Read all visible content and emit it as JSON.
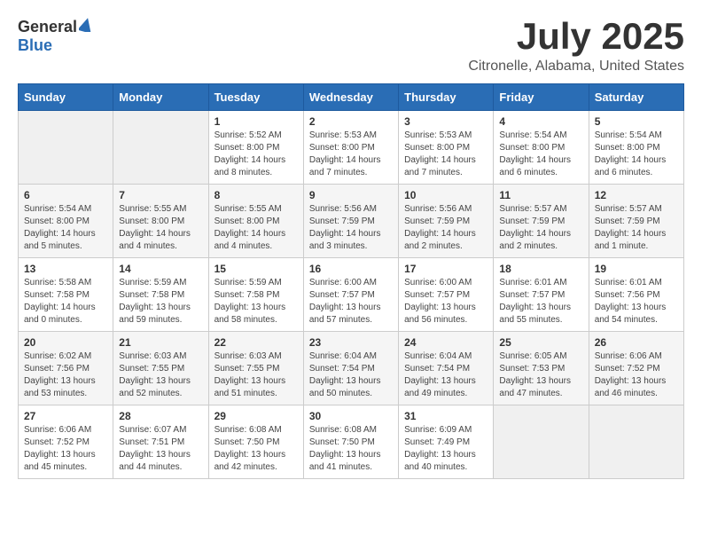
{
  "header": {
    "logo_general": "General",
    "logo_blue": "Blue",
    "title": "July 2025",
    "subtitle": "Citronelle, Alabama, United States"
  },
  "weekdays": [
    "Sunday",
    "Monday",
    "Tuesday",
    "Wednesday",
    "Thursday",
    "Friday",
    "Saturday"
  ],
  "weeks": [
    [
      {
        "day": "",
        "info": ""
      },
      {
        "day": "",
        "info": ""
      },
      {
        "day": "1",
        "info": "Sunrise: 5:52 AM\nSunset: 8:00 PM\nDaylight: 14 hours and 8 minutes."
      },
      {
        "day": "2",
        "info": "Sunrise: 5:53 AM\nSunset: 8:00 PM\nDaylight: 14 hours and 7 minutes."
      },
      {
        "day": "3",
        "info": "Sunrise: 5:53 AM\nSunset: 8:00 PM\nDaylight: 14 hours and 7 minutes."
      },
      {
        "day": "4",
        "info": "Sunrise: 5:54 AM\nSunset: 8:00 PM\nDaylight: 14 hours and 6 minutes."
      },
      {
        "day": "5",
        "info": "Sunrise: 5:54 AM\nSunset: 8:00 PM\nDaylight: 14 hours and 6 minutes."
      }
    ],
    [
      {
        "day": "6",
        "info": "Sunrise: 5:54 AM\nSunset: 8:00 PM\nDaylight: 14 hours and 5 minutes."
      },
      {
        "day": "7",
        "info": "Sunrise: 5:55 AM\nSunset: 8:00 PM\nDaylight: 14 hours and 4 minutes."
      },
      {
        "day": "8",
        "info": "Sunrise: 5:55 AM\nSunset: 8:00 PM\nDaylight: 14 hours and 4 minutes."
      },
      {
        "day": "9",
        "info": "Sunrise: 5:56 AM\nSunset: 7:59 PM\nDaylight: 14 hours and 3 minutes."
      },
      {
        "day": "10",
        "info": "Sunrise: 5:56 AM\nSunset: 7:59 PM\nDaylight: 14 hours and 2 minutes."
      },
      {
        "day": "11",
        "info": "Sunrise: 5:57 AM\nSunset: 7:59 PM\nDaylight: 14 hours and 2 minutes."
      },
      {
        "day": "12",
        "info": "Sunrise: 5:57 AM\nSunset: 7:59 PM\nDaylight: 14 hours and 1 minute."
      }
    ],
    [
      {
        "day": "13",
        "info": "Sunrise: 5:58 AM\nSunset: 7:58 PM\nDaylight: 14 hours and 0 minutes."
      },
      {
        "day": "14",
        "info": "Sunrise: 5:59 AM\nSunset: 7:58 PM\nDaylight: 13 hours and 59 minutes."
      },
      {
        "day": "15",
        "info": "Sunrise: 5:59 AM\nSunset: 7:58 PM\nDaylight: 13 hours and 58 minutes."
      },
      {
        "day": "16",
        "info": "Sunrise: 6:00 AM\nSunset: 7:57 PM\nDaylight: 13 hours and 57 minutes."
      },
      {
        "day": "17",
        "info": "Sunrise: 6:00 AM\nSunset: 7:57 PM\nDaylight: 13 hours and 56 minutes."
      },
      {
        "day": "18",
        "info": "Sunrise: 6:01 AM\nSunset: 7:57 PM\nDaylight: 13 hours and 55 minutes."
      },
      {
        "day": "19",
        "info": "Sunrise: 6:01 AM\nSunset: 7:56 PM\nDaylight: 13 hours and 54 minutes."
      }
    ],
    [
      {
        "day": "20",
        "info": "Sunrise: 6:02 AM\nSunset: 7:56 PM\nDaylight: 13 hours and 53 minutes."
      },
      {
        "day": "21",
        "info": "Sunrise: 6:03 AM\nSunset: 7:55 PM\nDaylight: 13 hours and 52 minutes."
      },
      {
        "day": "22",
        "info": "Sunrise: 6:03 AM\nSunset: 7:55 PM\nDaylight: 13 hours and 51 minutes."
      },
      {
        "day": "23",
        "info": "Sunrise: 6:04 AM\nSunset: 7:54 PM\nDaylight: 13 hours and 50 minutes."
      },
      {
        "day": "24",
        "info": "Sunrise: 6:04 AM\nSunset: 7:54 PM\nDaylight: 13 hours and 49 minutes."
      },
      {
        "day": "25",
        "info": "Sunrise: 6:05 AM\nSunset: 7:53 PM\nDaylight: 13 hours and 47 minutes."
      },
      {
        "day": "26",
        "info": "Sunrise: 6:06 AM\nSunset: 7:52 PM\nDaylight: 13 hours and 46 minutes."
      }
    ],
    [
      {
        "day": "27",
        "info": "Sunrise: 6:06 AM\nSunset: 7:52 PM\nDaylight: 13 hours and 45 minutes."
      },
      {
        "day": "28",
        "info": "Sunrise: 6:07 AM\nSunset: 7:51 PM\nDaylight: 13 hours and 44 minutes."
      },
      {
        "day": "29",
        "info": "Sunrise: 6:08 AM\nSunset: 7:50 PM\nDaylight: 13 hours and 42 minutes."
      },
      {
        "day": "30",
        "info": "Sunrise: 6:08 AM\nSunset: 7:50 PM\nDaylight: 13 hours and 41 minutes."
      },
      {
        "day": "31",
        "info": "Sunrise: 6:09 AM\nSunset: 7:49 PM\nDaylight: 13 hours and 40 minutes."
      },
      {
        "day": "",
        "info": ""
      },
      {
        "day": "",
        "info": ""
      }
    ]
  ]
}
